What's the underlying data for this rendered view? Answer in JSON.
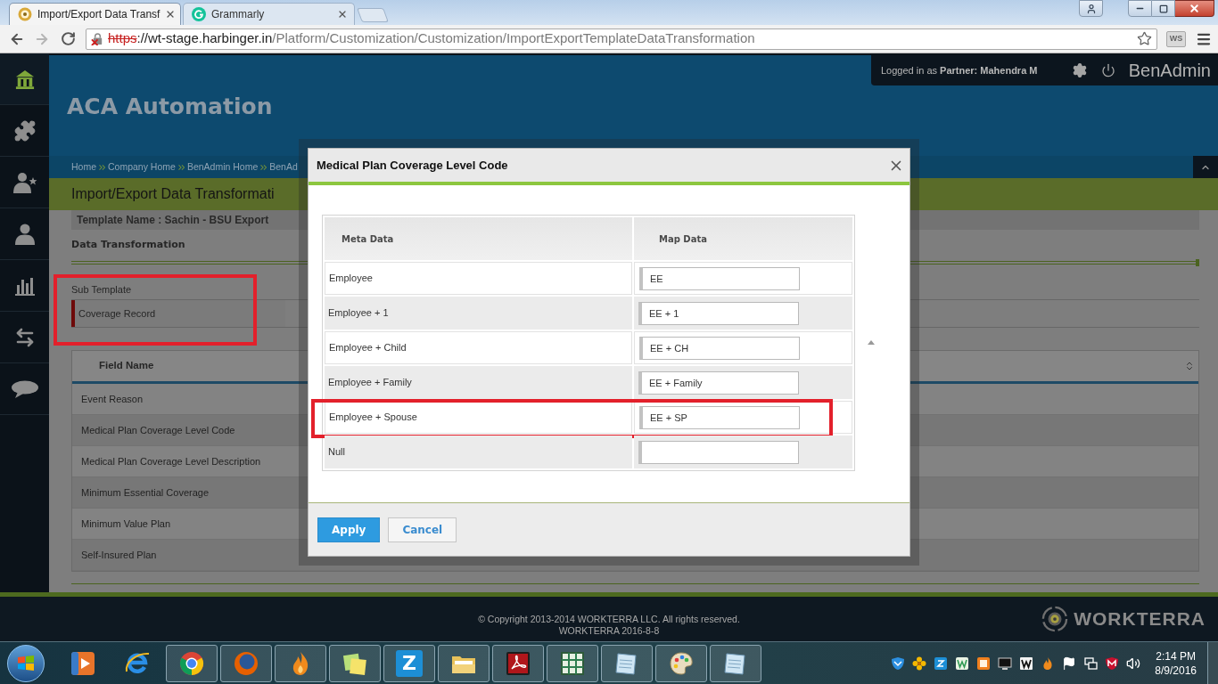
{
  "browser": {
    "tabs": [
      {
        "title": "Import/Export Data Transf",
        "kind": "page",
        "selected": true
      },
      {
        "title": "Grammarly",
        "kind": "grammarly",
        "selected": false
      }
    ],
    "address_bar": {
      "scheme": "https",
      "host": "://wt-stage.harbinger.in",
      "path": "/Platform/Customization/Customization/ImportExportTemplateDataTransformation"
    },
    "extension_label": "WS"
  },
  "sidebar": {
    "items": [
      {
        "kind": "home",
        "selected": true
      },
      {
        "kind": "puzzle",
        "selected": false
      },
      {
        "kind": "user-star",
        "selected": false
      },
      {
        "kind": "user",
        "selected": false
      },
      {
        "kind": "chart",
        "selected": false
      },
      {
        "kind": "transfer",
        "selected": false
      },
      {
        "kind": "chat",
        "selected": false
      }
    ]
  },
  "header": {
    "app_title": "ACA Automation",
    "login_text": "Logged in as **Partner: Mahendra M**",
    "product": "BenAdmin"
  },
  "breadcrumbs": [
    "Home",
    "Company Home",
    "BenAdmin Home",
    "BenAd"
  ],
  "page_title": "Import/Export Data Transformati",
  "template_name": "Template Name : Sachin - BSU Export",
  "section_title": "Data Transformation",
  "sub_template": {
    "label": "Sub Template",
    "highlighted": true,
    "items": [
      {
        "label": "Coverage Record",
        "selected": true
      }
    ]
  },
  "field_table": {
    "column": "Field Name",
    "rows": [
      "Event Reason",
      "Medical Plan Coverage Level Code",
      "Medical Plan Coverage Level Description",
      "Minimum Essential Coverage",
      "Minimum Value Plan",
      "Self-Insured Plan"
    ]
  },
  "dialog": {
    "title": "Medical Plan Coverage Level Code",
    "columns": [
      "Meta Data",
      "Map Data"
    ],
    "rows": [
      {
        "meta": "Employee",
        "map": "EE",
        "highlighted": false
      },
      {
        "meta": "Employee + 1",
        "map": "EE + 1",
        "highlighted": false
      },
      {
        "meta": "Employee + Child",
        "map": "EE + CH",
        "highlighted": false
      },
      {
        "meta": "Employee + Family",
        "map": "EE + Family",
        "highlighted": false
      },
      {
        "meta": "Employee + Spouse",
        "map": "EE + SP",
        "highlighted": true
      },
      {
        "meta": "Null",
        "highlighted": false
      }
    ],
    "buttons": [
      {
        "label": "Apply",
        "kind": "primary"
      },
      {
        "label": "Cancel",
        "kind": "secondary"
      }
    ]
  },
  "footer": {
    "copyright": "© Copyright 2013-2014 WORKTERRA LLC. All rights reserved.",
    "build": "WORKTERRA 2016-8-8",
    "logo": "WORKTERRA"
  },
  "taskbar": {
    "apps": [
      {
        "kind": "mediaplayer",
        "running": false
      },
      {
        "kind": "ie",
        "running": false
      },
      {
        "kind": "chrome",
        "running": true
      },
      {
        "kind": "firefox",
        "running": true
      },
      {
        "kind": "flame",
        "running": true
      },
      {
        "kind": "stickynotes",
        "running": true
      },
      {
        "kind": "zapp",
        "label": "Z",
        "running": true
      },
      {
        "kind": "explorer",
        "running": true
      },
      {
        "kind": "acrobat",
        "running": true
      },
      {
        "kind": "spreadsheet",
        "running": true
      },
      {
        "kind": "notepad",
        "running": true
      },
      {
        "kind": "paint",
        "running": true
      },
      {
        "kind": "notepad",
        "running": true
      }
    ],
    "time": "2:14 PM",
    "date": "8/9/2016"
  }
}
